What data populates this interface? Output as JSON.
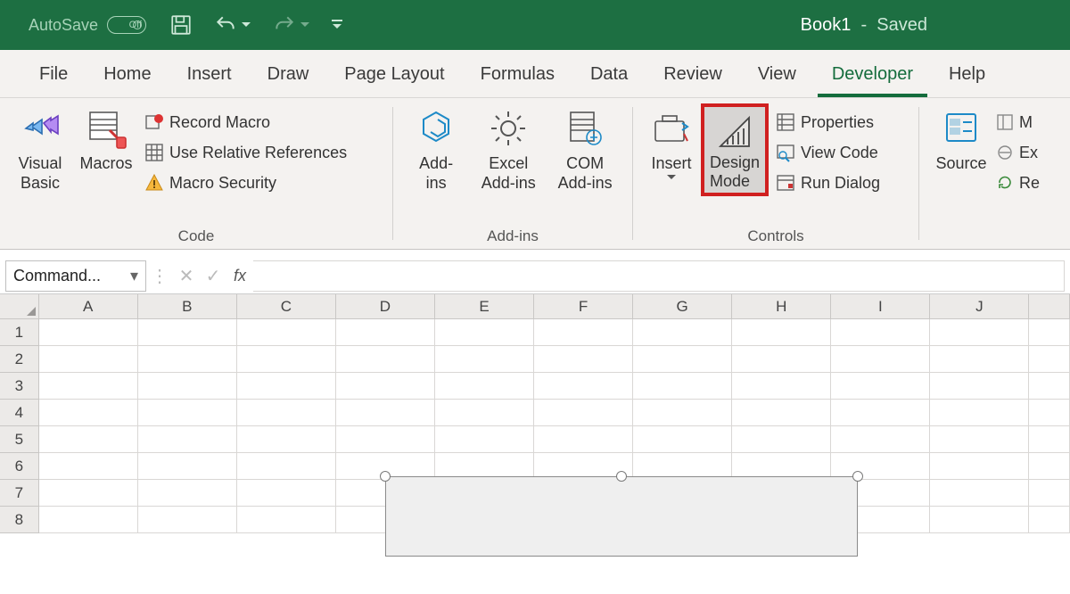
{
  "titlebar": {
    "autosave_label": "AutoSave",
    "autosave_state": "Off",
    "document_name": "Book1",
    "save_state": "Saved"
  },
  "tabs": {
    "file": "File",
    "home": "Home",
    "insert": "Insert",
    "draw": "Draw",
    "page_layout": "Page Layout",
    "formulas": "Formulas",
    "data": "Data",
    "review": "Review",
    "view": "View",
    "developer": "Developer",
    "help": "Help"
  },
  "ribbon": {
    "code": {
      "visual_basic": "Visual\nBasic",
      "macros": "Macros",
      "record_macro": "Record Macro",
      "use_relative": "Use Relative References",
      "macro_security": "Macro Security",
      "group_label": "Code"
    },
    "addins": {
      "addins": "Add-\nins",
      "excel_addins": "Excel\nAdd-ins",
      "com_addins": "COM\nAdd-ins",
      "group_label": "Add-ins"
    },
    "controls": {
      "insert": "Insert",
      "design_mode": "Design\nMode",
      "properties": "Properties",
      "view_code": "View Code",
      "run_dialog": "Run Dialog",
      "group_label": "Controls"
    },
    "xml": {
      "source": "Source",
      "map": "M",
      "expansion": "Ex",
      "refresh": "Re"
    }
  },
  "formula_bar": {
    "name_box": "Command...",
    "fx_label": "fx"
  },
  "grid": {
    "columns": [
      "A",
      "B",
      "C",
      "D",
      "E",
      "F",
      "G",
      "H",
      "I",
      "J"
    ],
    "rows": [
      "1",
      "2",
      "3",
      "4",
      "5",
      "6",
      "7",
      "8"
    ]
  }
}
